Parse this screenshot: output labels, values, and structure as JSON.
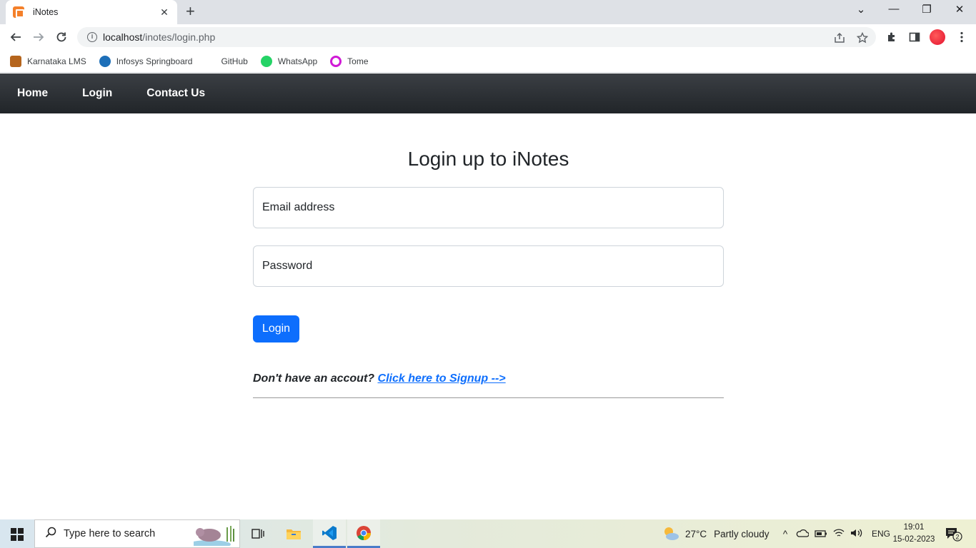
{
  "browser": {
    "tab_title": "iNotes",
    "url_host": "localhost",
    "url_path": "/inotes/login.php",
    "bookmarks": [
      "Karnataka LMS",
      "Infosys Springboard",
      "GitHub",
      "WhatsApp",
      "Tome"
    ]
  },
  "navbar": {
    "links": [
      "Home",
      "Login",
      "Contact Us"
    ]
  },
  "login_form": {
    "title": "Login up to iNotes",
    "email_placeholder": "Email address",
    "password_placeholder": "Password",
    "submit_label": "Login",
    "signup_prompt": "Don't have an accout?",
    "signup_link": "Click here to Signup -->"
  },
  "taskbar": {
    "search_placeholder": "Type here to search",
    "weather_temp": "27°C",
    "weather_desc": "Partly cloudy",
    "language": "ENG",
    "time": "19:01",
    "date": "15-02-2023",
    "notification_count": "2"
  },
  "colors": {
    "primary": "#0d6efd",
    "navbar": "#212529",
    "favicon": "#f4802a"
  }
}
